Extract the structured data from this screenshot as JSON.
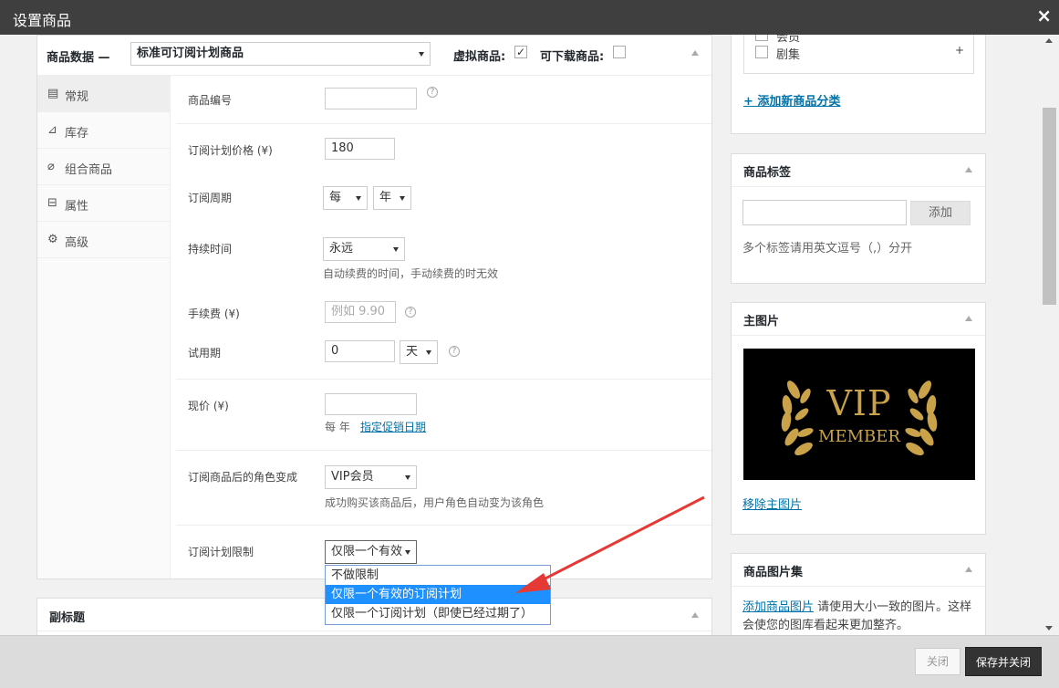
{
  "titlebar": {
    "title": "设置商品",
    "close_icon": "×"
  },
  "product_data": {
    "heading": "商品数据 —",
    "type_value": "标准可订阅计划商品",
    "virtual_label": "虚拟商品:",
    "downloadable_label": "可下载商品:",
    "virtual_checked": true,
    "downloadable_checked": false
  },
  "tabs": [
    {
      "label": "常规",
      "icon": "list-icon"
    },
    {
      "label": "库存",
      "icon": "chart-icon"
    },
    {
      "label": "组合商品",
      "icon": "link-icon"
    },
    {
      "label": "属性",
      "icon": "box-icon"
    },
    {
      "label": "高级",
      "icon": "gear-icon"
    }
  ],
  "fields": {
    "sku_label": "商品编号",
    "sku_value": "",
    "price_label": "订阅计划价格 (¥)",
    "price_value": "180",
    "period_label": "订阅周期",
    "period_every": "每",
    "period_unit": "年",
    "duration_label": "持续时间",
    "duration_value": "永远",
    "duration_hint": "自动续费的时间，手动续费的时无效",
    "fee_label": "手续费 (¥)",
    "fee_placeholder": "例如 9.90",
    "trial_label": "试用期",
    "trial_value": "0",
    "trial_unit": "天",
    "sale_label": "现价 (¥)",
    "sale_value": "",
    "sale_hint_prefix": "每 年",
    "sale_link": "指定促销日期",
    "role_label": "订阅商品后的角色变成",
    "role_value": "VIP会员",
    "role_hint": "成功购买该商品后，用户角色自动变为该角色",
    "limit_label": "订阅计划限制",
    "limit_value": "仅限一个有效",
    "limit_options": [
      "不做限制",
      "仅限一个有效的订阅计划",
      "仅限一个订阅计划（即使已经过期了）"
    ],
    "limit_selected_index": 1
  },
  "subtitle_panel": {
    "title": "副标题"
  },
  "categories": {
    "partial_item": "会员",
    "item": "剧集",
    "plus": "+",
    "add_link": "+ 添加新商品分类"
  },
  "tags": {
    "title": "商品标签",
    "add_button": "添加",
    "hint": "多个标签请用英文逗号（,）分开"
  },
  "featured": {
    "title": "主图片",
    "image_text_1": "VIP",
    "image_text_2": "MEMBER",
    "remove_link": "移除主图片"
  },
  "gallery": {
    "title": "商品图片集",
    "add_link": "添加商品图片",
    "hint": "请使用大小一致的图片。这样会使您的图库看起来更加整齐。"
  },
  "footer": {
    "close_label": "关闭",
    "save_label": "保存并关闭"
  },
  "colors": {
    "titlebar": "#3f3f3f",
    "link": "#0073aa",
    "highlight": "#1e90ff",
    "arrow": "#e53935"
  }
}
